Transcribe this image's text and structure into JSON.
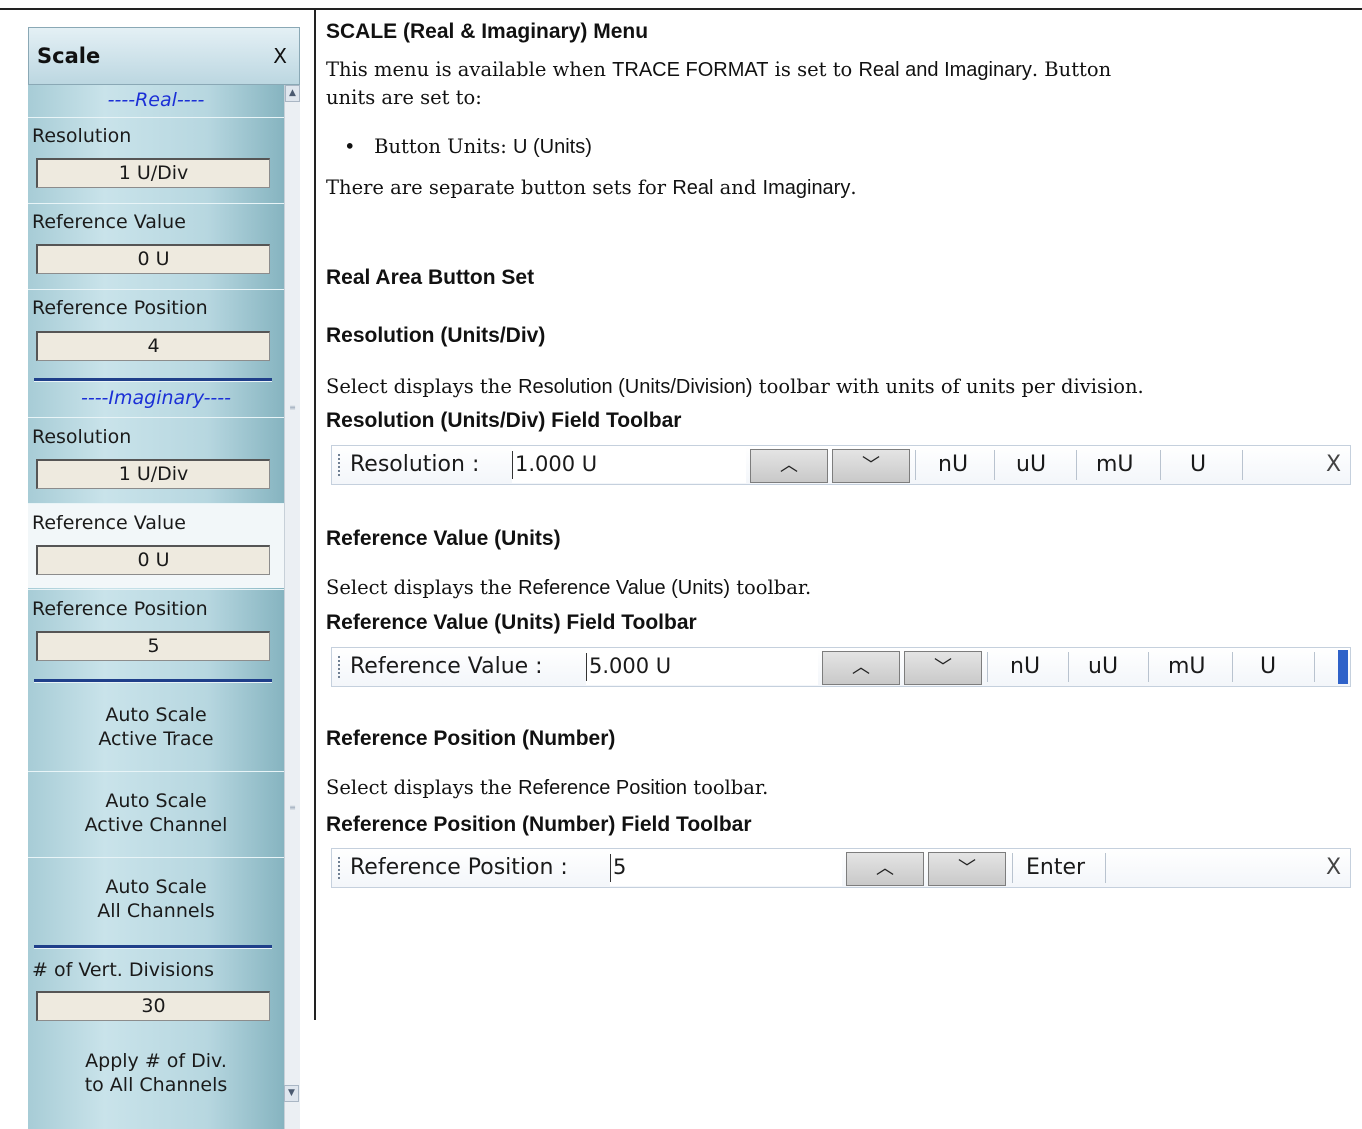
{
  "menu": {
    "title": "Scale",
    "close": "X",
    "real_header": "----Real----",
    "real_resolution_label": "Resolution",
    "real_resolution_value": "1 U/Div",
    "real_ref_value_label": "Reference Value",
    "real_ref_value_value": "0 U",
    "real_ref_pos_label": "Reference Position",
    "real_ref_pos_value": "4",
    "imag_header": "----Imaginary----",
    "imag_resolution_label": "Resolution",
    "imag_resolution_value": "1 U/Div",
    "imag_ref_value_label": "Reference Value",
    "imag_ref_value_value": "0 U",
    "imag_ref_pos_label": "Reference Position",
    "imag_ref_pos_value": "5",
    "auto_trace_l1": "Auto Scale",
    "auto_trace_l2": "Active Trace",
    "auto_channel_l1": "Auto Scale",
    "auto_channel_l2": "Active Channel",
    "auto_all_l1": "Auto Scale",
    "auto_all_l2": "All Channels",
    "vert_div_label": "# of Vert. Divisions",
    "vert_div_value": "30",
    "apply_l1": "Apply # of Div.",
    "apply_l2": "to All Channels"
  },
  "doc": {
    "title": "SCALE (Real & Imaginary) Menu",
    "intro_1a": "This menu is available when ",
    "intro_1b": "TRACE FORMAT",
    "intro_1c": " is set to ",
    "intro_1d": "Real and Imaginary",
    "intro_1e": ". Button",
    "intro_2": "units are set to:",
    "bullet_a": "Button Units: ",
    "bullet_b": "U (Units)",
    "sets_a": "There are separate button sets for ",
    "sets_b": "Real",
    "sets_c": " and ",
    "sets_d": "Imaginary",
    "sets_e": ".",
    "real_area": "Real Area Button Set",
    "res_heading": "Resolution (Units/Div)",
    "res_a": "Select displays the ",
    "res_b": "Resolution (Units/Division)",
    "res_c": " toolbar with units of units per division.",
    "res_tb_heading": "Resolution (Units/Div) Field Toolbar",
    "refval_heading": "Reference Value (Units)",
    "refval_a": "Select displays the ",
    "refval_b": "Reference Value (Units)",
    "refval_c": " toolbar.",
    "refval_tb_heading": "Reference Value (Units) Field Toolbar",
    "refpos_heading": "Reference Position (Number)",
    "refpos_a": "Select displays the ",
    "refpos_b": "Reference Position",
    "refpos_c": " toolbar.",
    "refpos_tb_heading": "Reference Position (Number) Field Toolbar"
  },
  "toolbars": {
    "res": {
      "label": "Resolution  :",
      "value": "1.000  U",
      "units": [
        "nU",
        "uU",
        "mU",
        "U"
      ],
      "close": "X"
    },
    "refval": {
      "label": "Reference Value  :",
      "value": "5.000  U",
      "units": [
        "nU",
        "uU",
        "mU",
        "U"
      ]
    },
    "refpos": {
      "label": "Reference Position  :",
      "value": "5",
      "enter": "Enter",
      "close": "X"
    }
  }
}
